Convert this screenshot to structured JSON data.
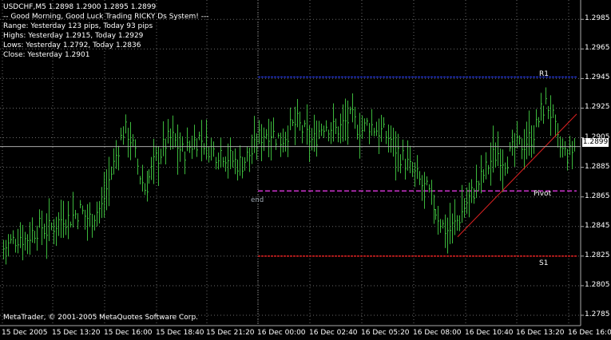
{
  "info": {
    "symbol_line": "USDCHF,M5  1.2898 1.2900 1.2895 1.2899",
    "greeting": "-- Good Morning, Good Luck Trading RICKY Ds System! ---",
    "range": "Range: Yesterday 123 pips, Today 93 pips",
    "highs": "Highs: Yesterday 1.2915, Today 1.2929",
    "lows": "Lows: Yesterday 1.2792, Today 1.2836",
    "close": "Close: Yesterday 1.2901"
  },
  "levels": {
    "r1_label": "R1",
    "pivot_label": "Pivot",
    "s1_label": "S1",
    "end_label": "end",
    "r1_color": "#2233cc",
    "pivot_color": "#cc33cc",
    "s1_color": "#dd2222"
  },
  "copyright": "MetaTrader, © 2001-2005 MetaQuotes Software Corp.",
  "current_price": "1.2899",
  "price_axis": [
    "1.2985",
    "1.2965",
    "1.2945",
    "1.2925",
    "1.2905",
    "1.2885",
    "1.2865",
    "1.2845",
    "1.2825",
    "1.2805",
    "1.2785"
  ],
  "time_axis": [
    "15 Dec 2005",
    "15 Dec 13:20",
    "15 Dec 16:00",
    "15 Dec 18:40",
    "15 Dec 21:20",
    "16 Dec 00:00",
    "16 Dec 02:40",
    "16 Dec 05:20",
    "16 Dec 08:00",
    "16 Dec 10:40",
    "16 Dec 13:20",
    "16 Dec 16:00"
  ],
  "chart_data": {
    "type": "bar",
    "symbol": "USDCHF",
    "timeframe": "M5",
    "ylim": [
      1.2778,
      1.2997
    ],
    "bar_color": "#3cb83c",
    "trendline_color": "#dd2222",
    "levels": {
      "R1": 1.2946,
      "Pivot": 1.2869,
      "S1": 1.2825,
      "current": 1.2899
    },
    "trendline": {
      "from": 1.2838,
      "to": 1.2921
    },
    "close_path": [
      1.283,
      1.2833,
      1.2836,
      1.2839,
      1.2836,
      1.284,
      1.2843,
      1.2845,
      1.2842,
      1.2845,
      1.2848,
      1.2852,
      1.285,
      1.2853,
      1.2856,
      1.2852,
      1.285,
      1.2855,
      1.2858,
      1.2872,
      1.2884,
      1.2898,
      1.291,
      1.2908,
      1.2895,
      1.288,
      1.287,
      1.288,
      1.289,
      1.2895,
      1.2902,
      1.2905,
      1.29,
      1.2895,
      1.2898,
      1.2902,
      1.2905,
      1.2902,
      1.2898,
      1.2895,
      1.2896,
      1.2893,
      1.289,
      1.2888,
      1.2888,
      1.2893,
      1.2896,
      1.2905,
      1.2908,
      1.291,
      1.2906,
      1.2903,
      1.2908,
      1.2912,
      1.2915,
      1.291,
      1.2905,
      1.2902,
      1.291,
      1.2915,
      1.2913,
      1.291,
      1.2912,
      1.2916,
      1.2918,
      1.2913,
      1.291,
      1.2915,
      1.2912,
      1.291,
      1.2907,
      1.2905,
      1.2898,
      1.2893,
      1.2888,
      1.2882,
      1.2878,
      1.2872,
      1.2868,
      1.286,
      1.2852,
      1.2844,
      1.2842,
      1.2846,
      1.2852,
      1.286,
      1.2866,
      1.2872,
      1.2878,
      1.2885,
      1.2892,
      1.2895,
      1.289,
      1.2892,
      1.2898,
      1.29,
      1.2902,
      1.2905,
      1.2912,
      1.2924,
      1.2928,
      1.2918,
      1.29,
      1.2895,
      1.2893,
      1.2899
    ]
  }
}
